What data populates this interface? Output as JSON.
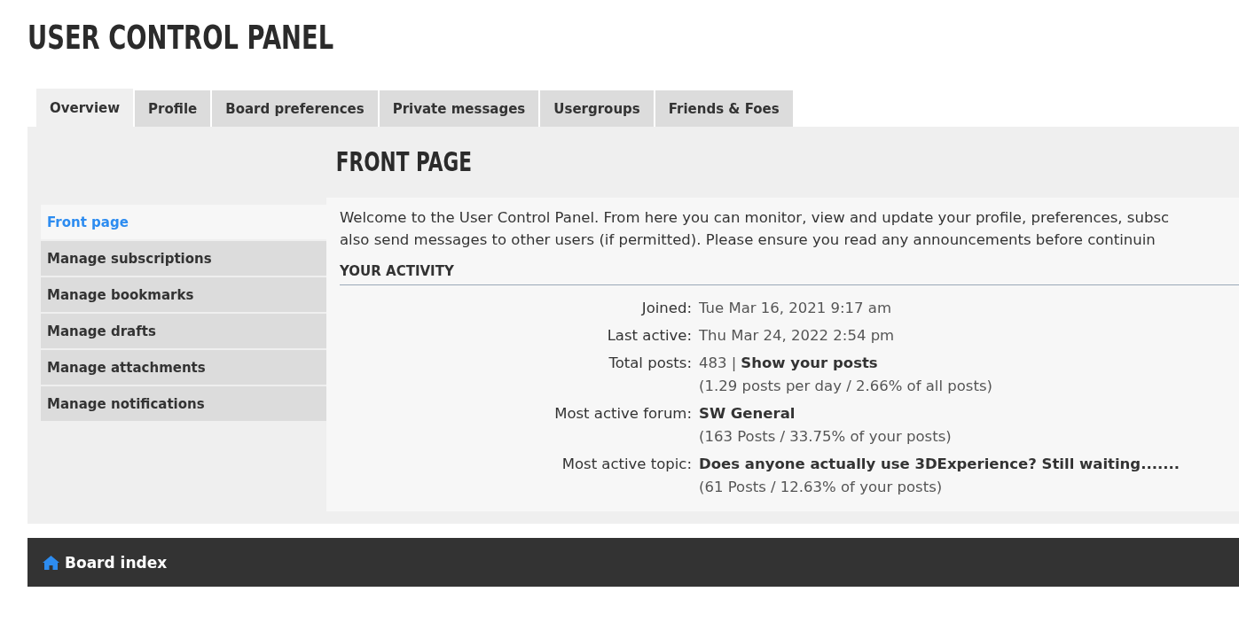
{
  "page_title": "USER CONTROL PANEL",
  "tabs": [
    {
      "label": "Overview",
      "selected": true
    },
    {
      "label": "Profile",
      "selected": false
    },
    {
      "label": "Board preferences",
      "selected": false
    },
    {
      "label": "Private messages",
      "selected": false
    },
    {
      "label": "Usergroups",
      "selected": false
    },
    {
      "label": "Friends & Foes",
      "selected": false
    }
  ],
  "sidebar": {
    "items": [
      {
        "label": "Front page",
        "selected": true
      },
      {
        "label": "Manage subscriptions",
        "selected": false
      },
      {
        "label": "Manage bookmarks",
        "selected": false
      },
      {
        "label": "Manage drafts",
        "selected": false
      },
      {
        "label": "Manage attachments",
        "selected": false
      },
      {
        "label": "Manage notifications",
        "selected": false
      }
    ]
  },
  "content": {
    "heading": "FRONT PAGE",
    "intro_lines": [
      "Welcome to the User Control Panel. From here you can monitor, view and update your profile, preferences, subsc",
      "also send messages to other users (if permitted). Please ensure you read any announcements before continuin"
    ],
    "section_title": "YOUR ACTIVITY",
    "activity": [
      {
        "label": "Joined:",
        "value": "Tue Mar 16, 2021 9:17 am"
      },
      {
        "label": "Last active:",
        "value": "Thu Mar 24, 2022 2:54 pm"
      },
      {
        "label": "Total posts:",
        "value": "483 |",
        "link": "Show your posts",
        "detail": "(1.29 posts per day / 2.66% of all posts)"
      },
      {
        "label": "Most active forum:",
        "link": "SW General",
        "detail": "(163 Posts / 33.75% of your posts)"
      },
      {
        "label": "Most active topic:",
        "link": "Does anyone actually use 3DExperience? Still waiting.......",
        "detail": "(61 Posts / 12.63% of your posts)"
      }
    ]
  },
  "footer": {
    "link": "Board index"
  }
}
